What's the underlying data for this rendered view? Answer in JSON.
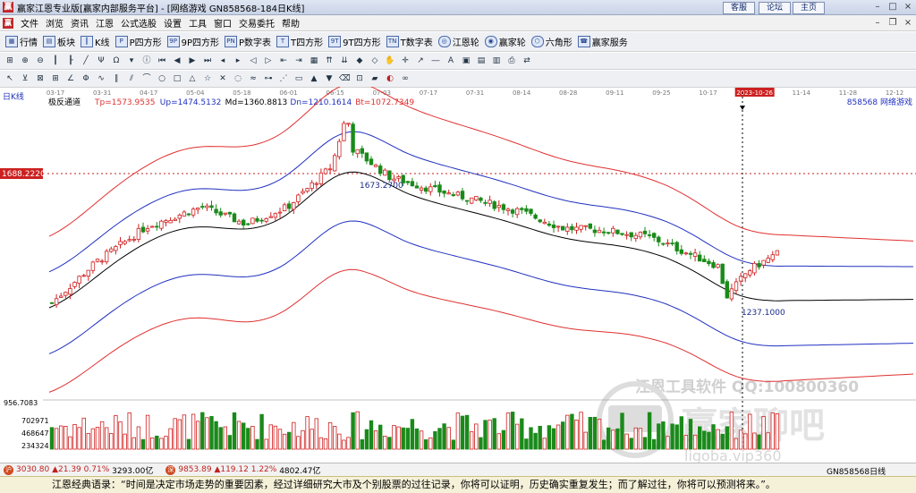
{
  "window": {
    "title": "赢家江恩专业版[赢家内部服务平台] - [网络游戏   GN858568-184日K线]",
    "links": [
      "客服",
      "论坛",
      "主页"
    ]
  },
  "menu": [
    "文件",
    "浏览",
    "资讯",
    "江恩",
    "公式选股",
    "设置",
    "工具",
    "窗口",
    "交易委托",
    "帮助"
  ],
  "toolbar1": [
    {
      "label": "行情",
      "icon": "grid-icon"
    },
    {
      "label": "板块",
      "icon": "blocks-icon"
    },
    {
      "label": "K线",
      "icon": "candle-icon"
    },
    {
      "label": "P四方形",
      "icon": "p-square-icon"
    },
    {
      "label": "9P四方形",
      "icon": "9p-square-icon"
    },
    {
      "label": "P数字表",
      "icon": "p-table-icon"
    },
    {
      "label": "T四方形",
      "icon": "t-square-icon"
    },
    {
      "label": "9T四方形",
      "icon": "9t-square-icon"
    },
    {
      "label": "T数字表",
      "icon": "t-table-icon"
    },
    {
      "label": "江恩轮",
      "icon": "wheel-icon"
    },
    {
      "label": "赢家轮",
      "icon": "wheel2-icon"
    },
    {
      "label": "六角形",
      "icon": "hexagon-icon"
    },
    {
      "label": "赢家服务",
      "icon": "service-icon"
    }
  ],
  "chart": {
    "period_label": "日K线",
    "indicator_name": "极反通道",
    "indicator_values": [
      {
        "text": "Tp=1573.9535",
        "color": "#e03030"
      },
      {
        "text": "Up=1474.5132",
        "color": "#2030c0"
      },
      {
        "text": "Md=1360.8813",
        "color": "#000000"
      },
      {
        "text": "Dn=1210.1614",
        "color": "#2030c0"
      },
      {
        "text": "Bt=1072.7349",
        "color": "#e03030"
      }
    ],
    "stock_code_label": "858568  网络游戏",
    "date_ticks": [
      "03-17",
      "03-31",
      "04-17",
      "05-04",
      "05-18",
      "06-01",
      "06-15",
      "07-03",
      "07-17",
      "07-31",
      "08-14",
      "08-28",
      "09-11",
      "09-25",
      "10-17",
      "2023-10-26",
      "11-14",
      "11-28",
      "12-12"
    ],
    "cursor_date": "2023-10-26",
    "cursor_price": "1688.2220",
    "high_label": "1673.2700",
    "low_label": "1237.1000",
    "volume_axis": [
      "956.7083",
      "702971",
      "468647",
      "234324"
    ],
    "colors": {
      "up": "#d02020",
      "down": "#1a8a1a",
      "upper_band": "#2030c0",
      "outer_band": "#e03030",
      "mid_band": "#000000"
    }
  },
  "watermarks": {
    "software": "江恩工具软件   QQ:100800360",
    "brand": "赢家聊吧",
    "site": "ligoba.vip360"
  },
  "statusbar": {
    "index1_value": "3030.80",
    "index1_change": "▲21.39",
    "index1_pct": "0.71%",
    "index1_amount": "3293.00亿",
    "index2_value": "9853.89",
    "index2_change": "▲119.12",
    "index2_pct": "1.22%",
    "index2_amount": "4802.47亿",
    "right_label": "GN858568日线"
  },
  "quote": "江恩经典语录：“时间是决定市场走势的重要因素，经过详细研究大市及个别股票的过往记录，你将可以证明，历史确实重复发生；而了解过往，你将可以预测将来。”。",
  "chart_data": {
    "type": "candlestick",
    "x_range": [
      "03-17",
      "12-12"
    ],
    "y_range": [
      1050,
      1700
    ],
    "close_path": [
      {
        "x": "03-17",
        "y": 1225
      },
      {
        "x": "03-31",
        "y": 1320
      },
      {
        "x": "04-17",
        "y": 1405
      },
      {
        "x": "05-04",
        "y": 1450
      },
      {
        "x": "05-18",
        "y": 1410
      },
      {
        "x": "06-01",
        "y": 1450
      },
      {
        "x": "06-15",
        "y": 1545
      },
      {
        "x": "06-20",
        "y": 1673
      },
      {
        "x": "06-21",
        "y": 1590
      },
      {
        "x": "07-03",
        "y": 1520
      },
      {
        "x": "07-17",
        "y": 1490
      },
      {
        "x": "07-31",
        "y": 1465
      },
      {
        "x": "08-14",
        "y": 1440
      },
      {
        "x": "08-28",
        "y": 1400
      },
      {
        "x": "09-11",
        "y": 1395
      },
      {
        "x": "09-25",
        "y": 1380
      },
      {
        "x": "10-17",
        "y": 1310
      },
      {
        "x": "10-19",
        "y": 1237
      },
      {
        "x": "10-26",
        "y": 1300
      },
      {
        "x": "11-06",
        "y": 1345
      }
    ]
  }
}
